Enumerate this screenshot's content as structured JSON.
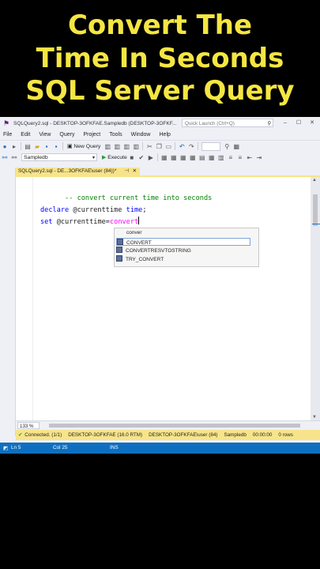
{
  "headline": {
    "line1": "Convert The",
    "line2": "Time In Seconds",
    "line3": "SQL Server Query"
  },
  "window": {
    "title": "SQLQuery2.sql - DESKTOP-3OFKFAE.Sampledb (DESKTOP-3OFKF...",
    "quick_launch_placeholder": "Quick Launch (Ctrl+Q)"
  },
  "menu": {
    "items": [
      "File",
      "Edit",
      "View",
      "Query",
      "Project",
      "Tools",
      "Window",
      "Help"
    ]
  },
  "toolbar": {
    "new_query_label": "New Query",
    "database": "Sampledb",
    "execute_label": "Execute"
  },
  "tab": {
    "title": "SQLQuery2.sql - DE...3OFKFAE\\user (84))*",
    "pin": "⊣",
    "close": "✕"
  },
  "editor": {
    "lines": [
      {
        "comment": "-- convert current time into seconds"
      },
      {
        "kw": "declare",
        "rest": " @currenttime ",
        "kw2": "time",
        "end": ";"
      },
      {
        "kw": "set",
        "rest": " @currenttime",
        "op": "=",
        "fn": "convert"
      }
    ]
  },
  "autocomplete": {
    "filter": "conver",
    "items": [
      "CONVERT",
      "CONVERTRESVTOSTRING",
      "TRY_CONVERT"
    ],
    "selected_index": 0
  },
  "editor_zoom": "133 %",
  "status": {
    "connected": "Connected. (1/1)",
    "server": "DESKTOP-3OFKFAE (16.0 RTM)",
    "user": "DESKTOP-3OFKFAE\\user (84)",
    "database": "Sampledb",
    "elapsed": "00:00:00",
    "rows": "0 rows"
  },
  "bottom": {
    "ln": "Ln 5",
    "col": "Col 25",
    "mode": "INS"
  },
  "colors": {
    "headline": "#f5e642",
    "tab_active": "#f7e48a",
    "statusbar_bottom": "#0e6fc0",
    "keyword": "#0000ff",
    "comment": "#008000",
    "function": "#ff00ff"
  }
}
